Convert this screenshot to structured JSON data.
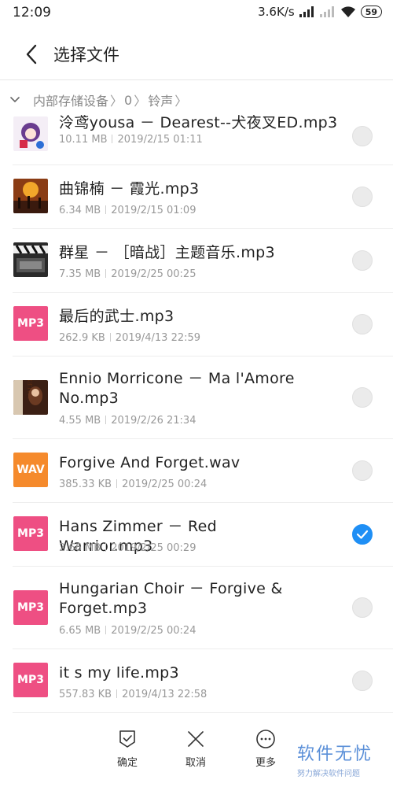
{
  "status_bar": {
    "time": "12:09",
    "speed": "3.6K/s",
    "battery": "59"
  },
  "header": {
    "title": "选择文件"
  },
  "breadcrumb": {
    "root": "内部存储设备",
    "level1": "0",
    "level2": "铃声"
  },
  "files": [
    {
      "name": "泠鸢yousa － Dearest--犬夜叉ED.mp3",
      "size": "10.11 MB",
      "date": "2019/2/15 01:11",
      "type": "image",
      "checked": false
    },
    {
      "name": "曲锦楠 － 霞光.mp3",
      "size": "6.34 MB",
      "date": "2019/2/15 01:09",
      "type": "image",
      "checked": false
    },
    {
      "name": "群星 － ［暗战］主题音乐.mp3",
      "size": "7.35 MB",
      "date": "2019/2/25 00:25",
      "type": "image",
      "checked": false
    },
    {
      "name": "最后的武士.mp3",
      "size": "262.9 KB",
      "date": "2019/4/13 22:59",
      "type": "MP3",
      "checked": false
    },
    {
      "name": "Ennio Morricone － Ma l'Amore No.mp3",
      "size": "4.55 MB",
      "date": "2019/2/26 21:34",
      "type": "image",
      "checked": false
    },
    {
      "name": "Forgive And Forget.wav",
      "size": "385.33 KB",
      "date": "2019/2/25 00:24",
      "type": "WAV",
      "checked": false
    },
    {
      "name": "Hans Zimmer － Red Warrior.mp3",
      "size": "2.66 MB",
      "date": "2019/2/25 00:29",
      "type": "MP3",
      "checked": true
    },
    {
      "name": "Hungarian Choir － Forgive & Forget.mp3",
      "size": "6.65 MB",
      "date": "2019/2/25 00:24",
      "type": "MP3",
      "checked": false
    },
    {
      "name": "it s my life.mp3",
      "size": "557.83 KB",
      "date": "2019/4/13 22:58",
      "type": "MP3",
      "checked": false
    }
  ],
  "footer": {
    "confirm": "确定",
    "cancel": "取消",
    "more": "更多"
  },
  "watermark": {
    "main": "软件无忧",
    "sub": "努力解决软件问题"
  },
  "colors": {
    "mp3_badge": "#ee4f83",
    "wav_badge": "#f58a2c",
    "check_active": "#1f8ff5"
  }
}
